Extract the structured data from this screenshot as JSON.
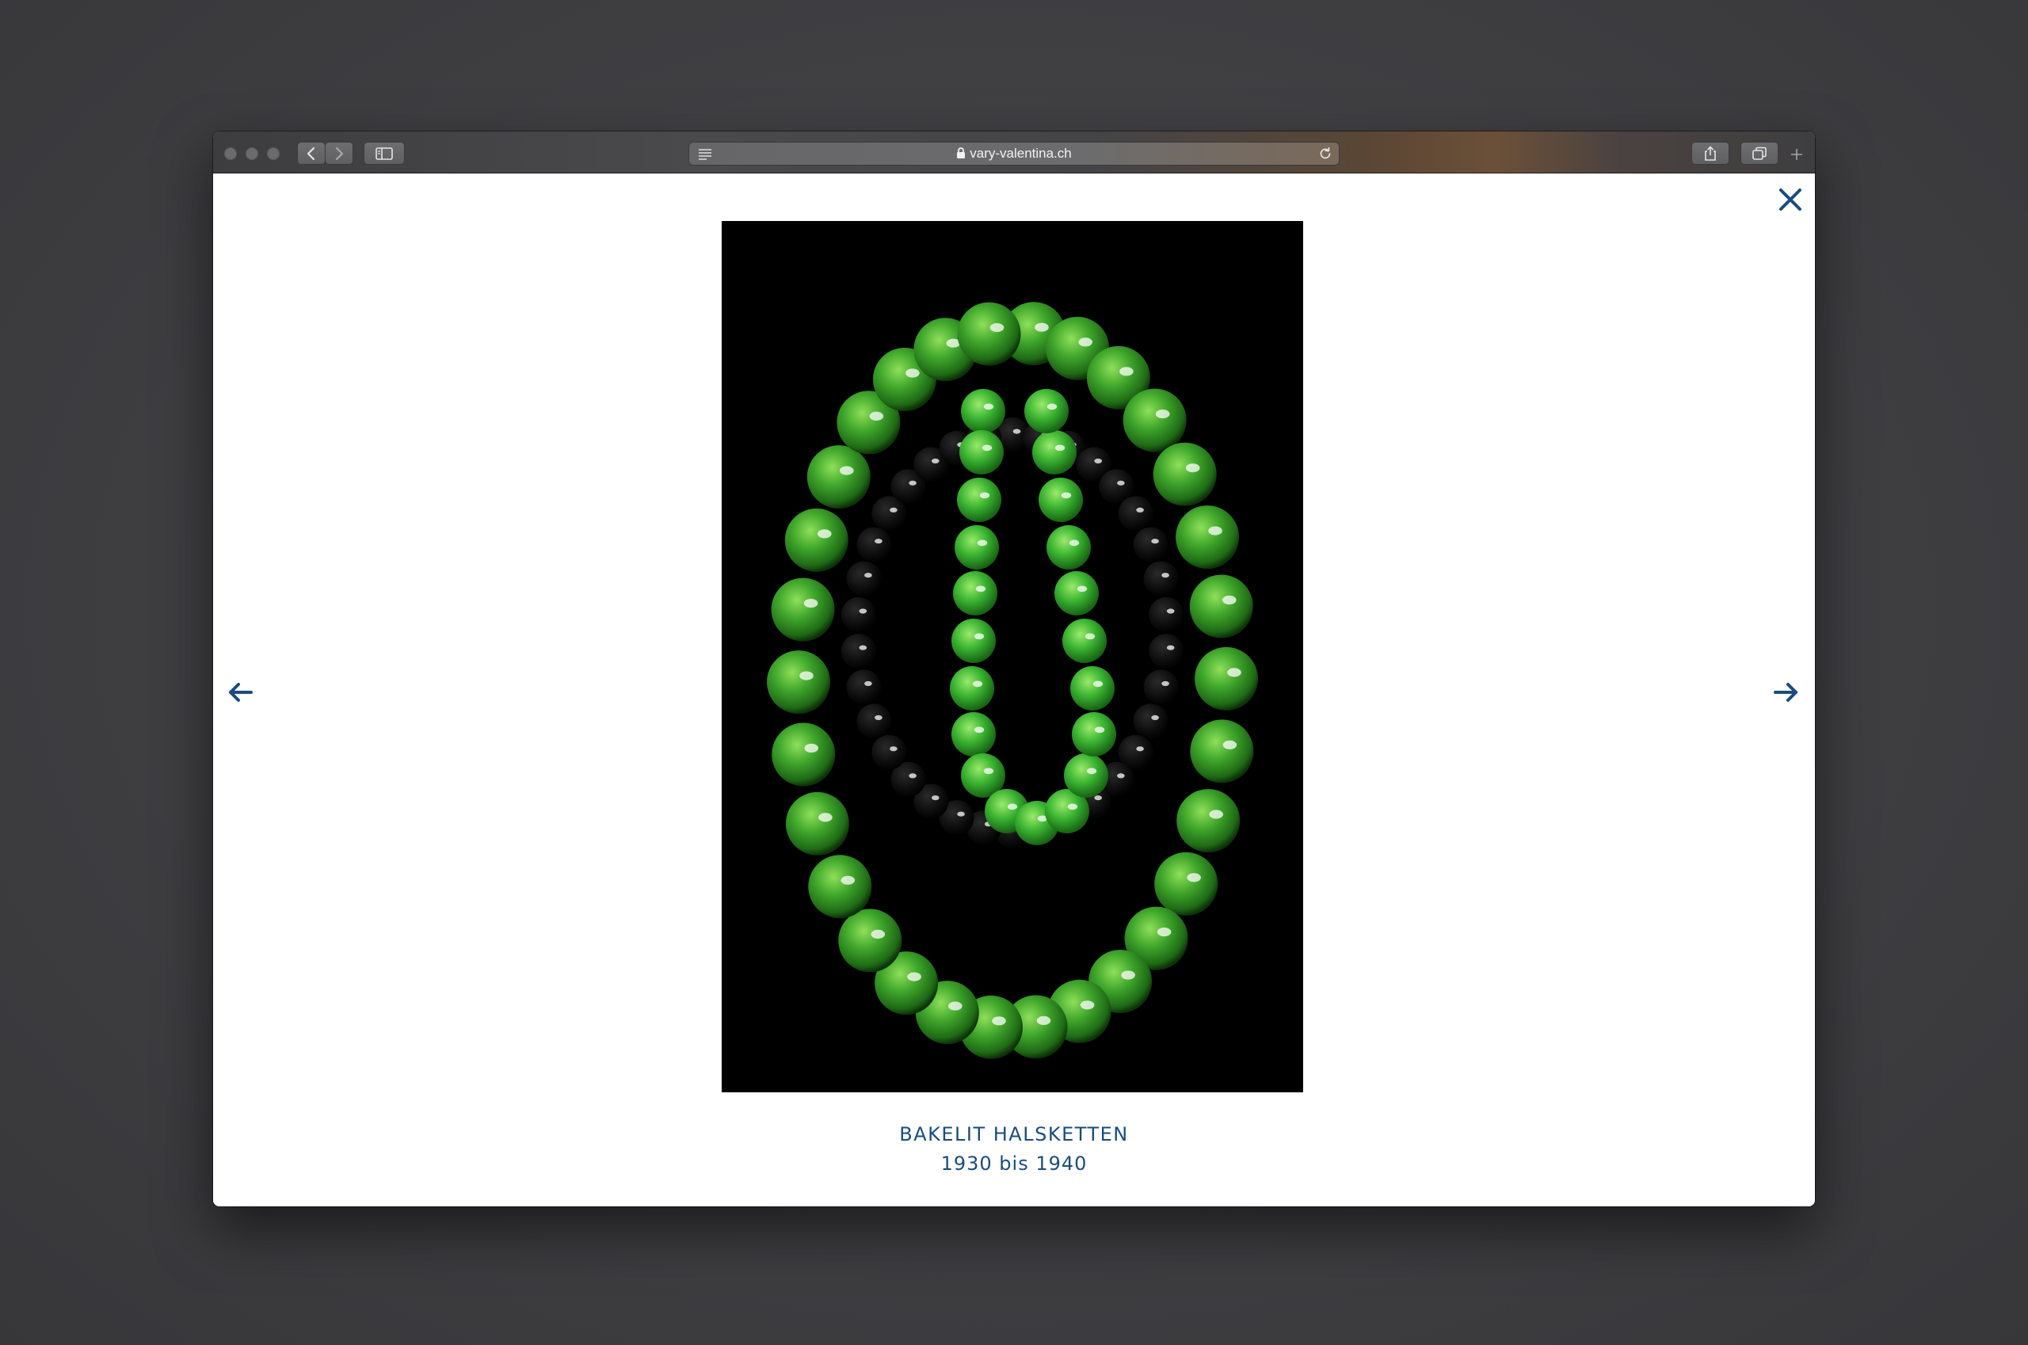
{
  "browser": {
    "url": "vary-valentina.ch"
  },
  "lightbox": {
    "title": "BAKELIT HALSKETTEN",
    "subtitle": "1930 bis 1940"
  },
  "icons": {
    "close": "close-icon",
    "previous": "arrow-left-icon",
    "next": "arrow-right-icon"
  },
  "colors": {
    "accent": "#1a4c7e",
    "bead_green": "#3aa52a",
    "photo_background": "#000000"
  }
}
